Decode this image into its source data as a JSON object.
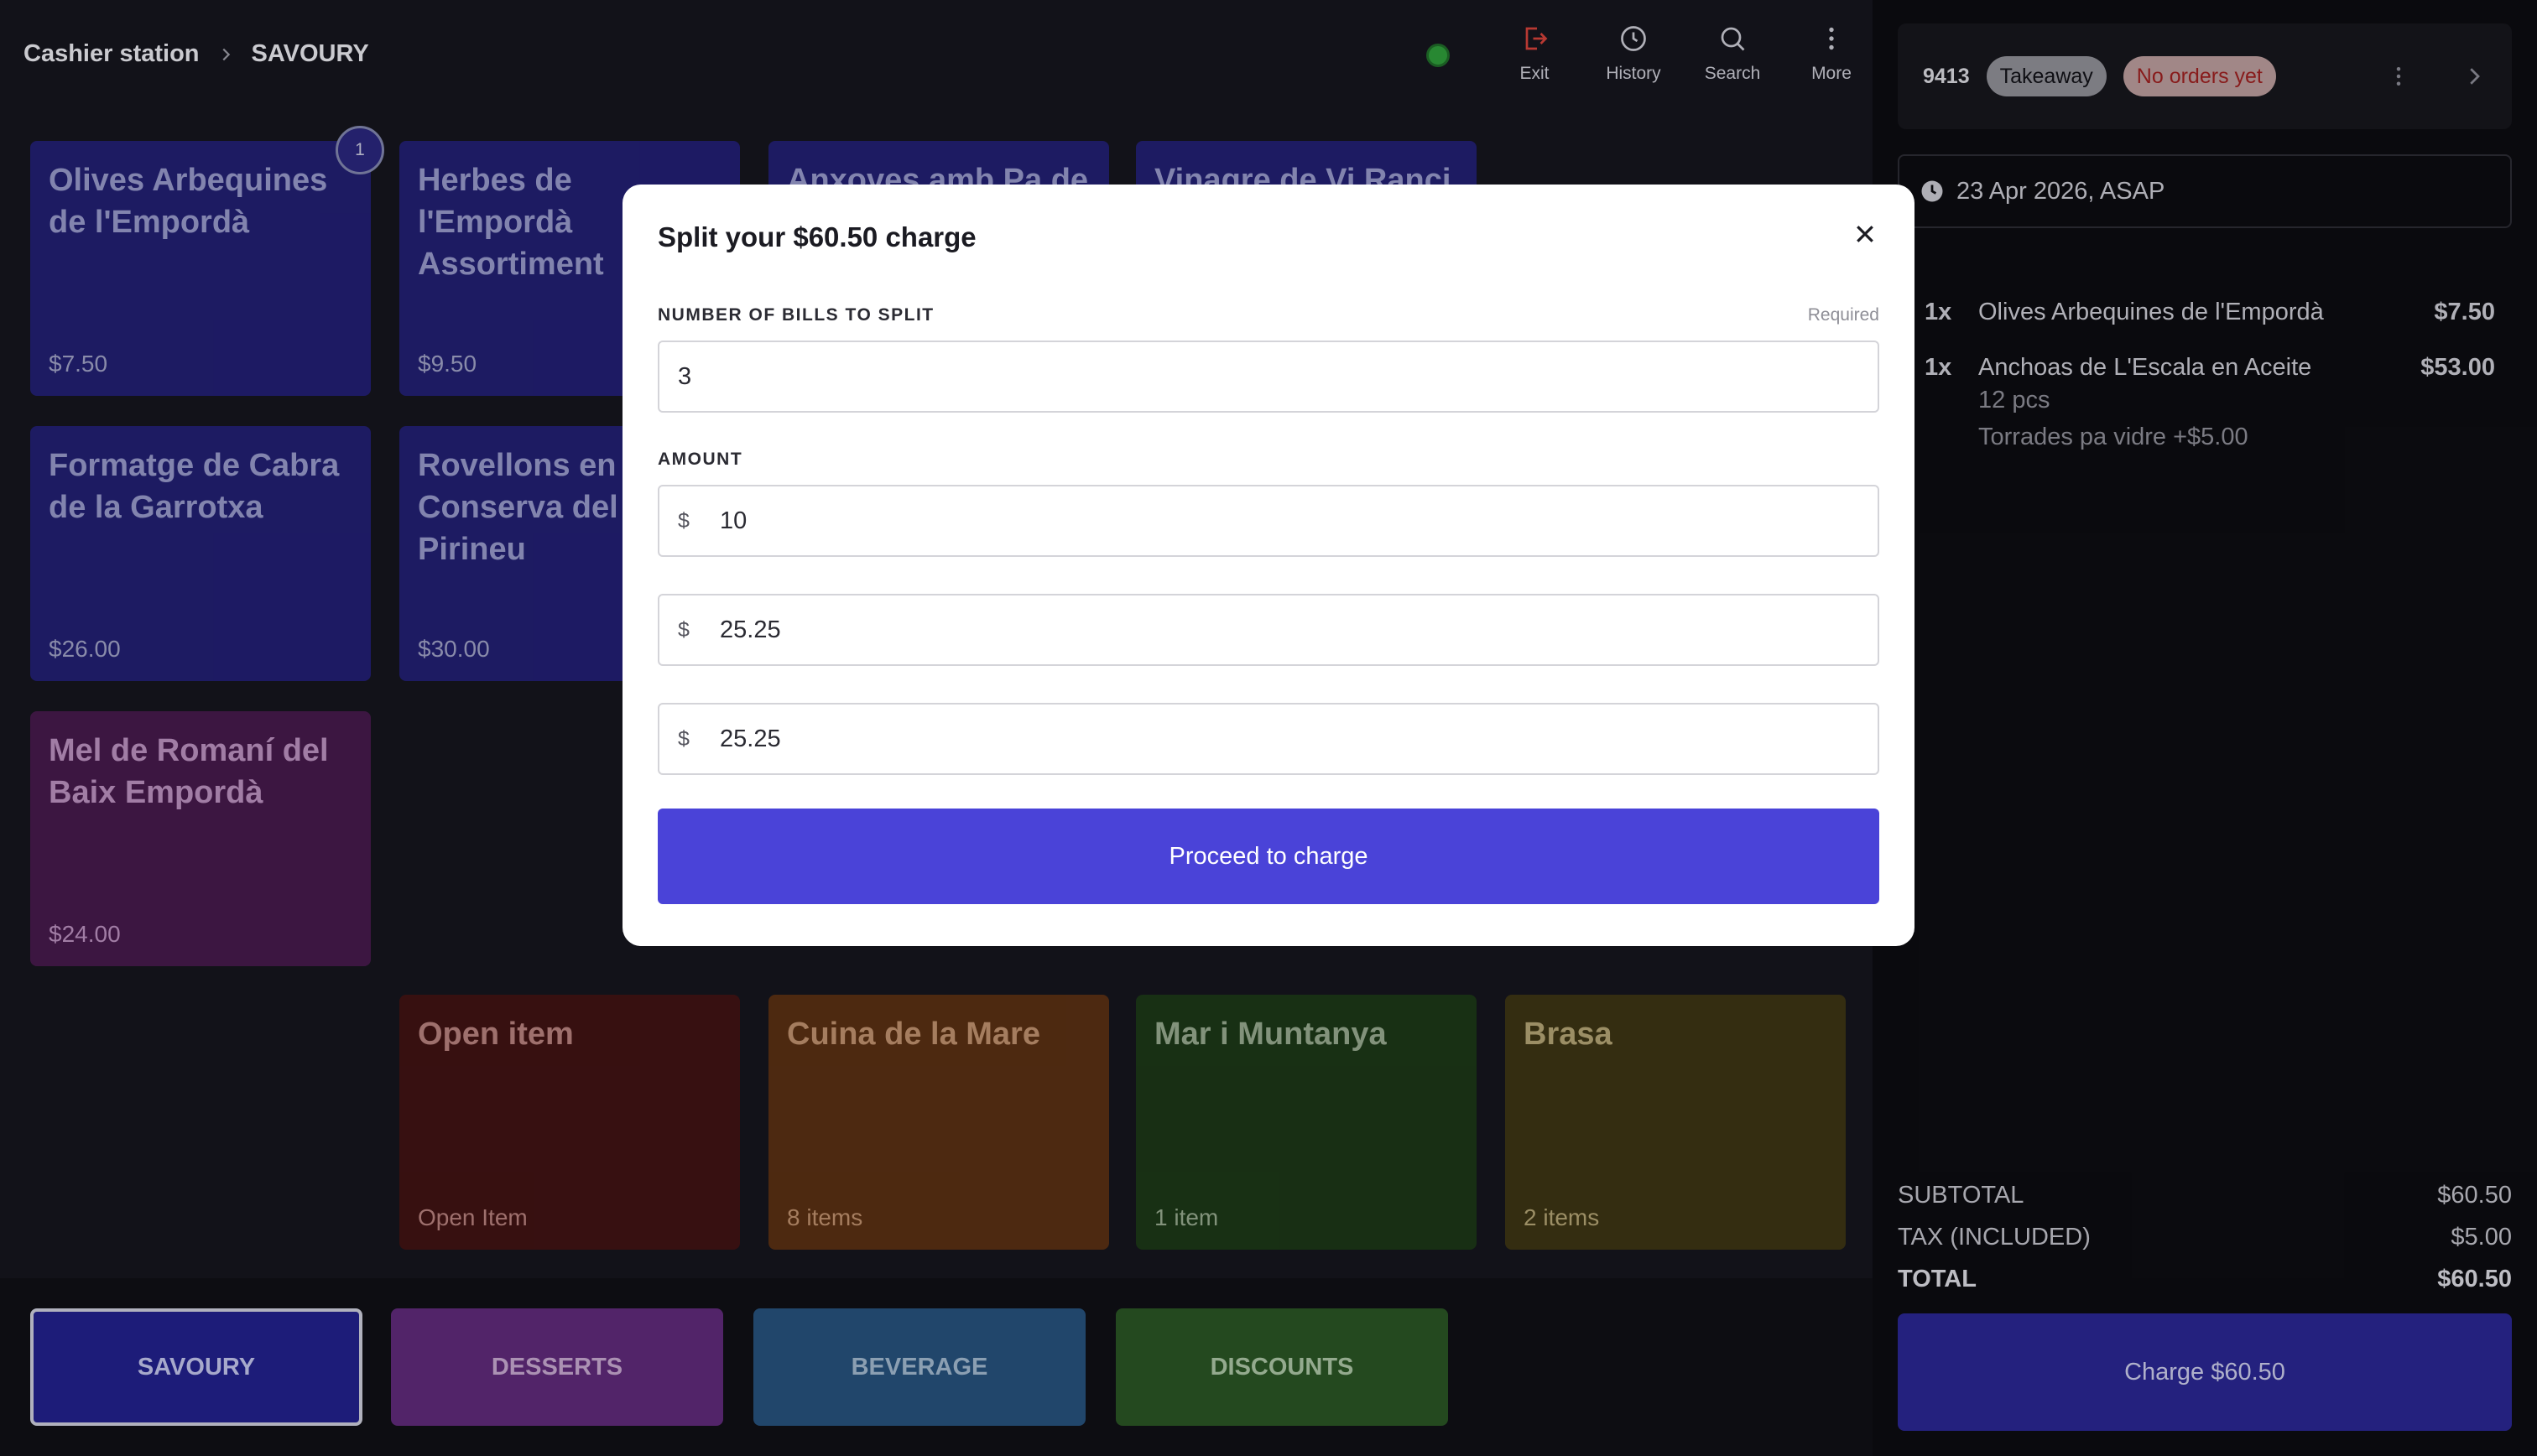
{
  "breadcrumb": {
    "root": "Cashier station",
    "current": "SAVOURY"
  },
  "toolbar": {
    "exit": "Exit",
    "history": "History",
    "search": "Search",
    "more": "More"
  },
  "status": {
    "online_color": "#2e9b3a"
  },
  "products": [
    {
      "name": "Olives Arbequines de l'Empordà",
      "price": "$7.50",
      "qty_badge": "1"
    },
    {
      "name": "Herbes de l'Empordà Assortiment",
      "price": "$9.50"
    },
    {
      "name": "Anxoves amb Pa de"
    },
    {
      "name": "Vinagre de Vi Ranci"
    },
    {
      "name": "Formatge de Cabra de la Garrotxa",
      "price": "$26.00"
    },
    {
      "name": "Rovellons en Conserva del Pirineu",
      "price": "$30.00"
    },
    {
      "name": "Mel de Romaní del Baix Empordà",
      "price": "$24.00"
    }
  ],
  "groups": [
    {
      "name": "Open item",
      "sub": "Open Item"
    },
    {
      "name": "Cuina de la Mare",
      "sub": "8 items"
    },
    {
      "name": "Mar i Muntanya",
      "sub": "1 item"
    },
    {
      "name": "Brasa",
      "sub": "2 items"
    }
  ],
  "categories": {
    "savoury": "SAVOURY",
    "desserts": "DESSERTS",
    "beverage": "BEVERAGE",
    "discounts": "DISCOUNTS"
  },
  "order": {
    "number": "9413",
    "type": "Takeaway",
    "status": "No orders yet",
    "date": "23 Apr 2026, ASAP",
    "items": [
      {
        "qty": "1x",
        "name": "Olives Arbequines de l'Empordà",
        "price": "$7.50"
      },
      {
        "qty": "1x",
        "name": "Anchoas de L'Escala en Aceite",
        "price": "$53.00",
        "mods": [
          "12 pcs",
          "Torrades pa vidre +$5.00"
        ]
      }
    ],
    "subtotal_label": "SUBTOTAL",
    "subtotal": "$60.50",
    "tax_label": "TAX (INCLUDED)",
    "tax": "$5.00",
    "total_label": "TOTAL",
    "total": "$60.50",
    "charge_label": "Charge $60.50"
  },
  "modal": {
    "title": "Split your $60.50 charge",
    "bills_label": "NUMBER OF BILLS TO SPLIT",
    "required": "Required",
    "bills_value": "3",
    "amount_label": "AMOUNT",
    "currency": "$",
    "amounts": [
      "10",
      "25.25",
      "25.25"
    ],
    "proceed": "Proceed to charge"
  }
}
